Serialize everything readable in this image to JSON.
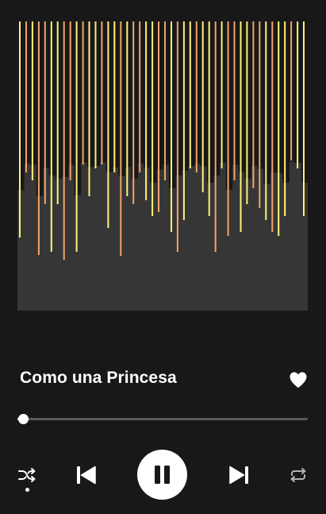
{
  "player": {
    "artwork": {
      "description_icon": "equalizer-bars-artwork",
      "colors": {
        "background": "#363636",
        "bar_yellow": "#fff27a",
        "bar_orange": "#f4a36c"
      }
    },
    "track": {
      "title": "Como una Princesa",
      "liked": true
    },
    "progress": {
      "fraction": 0.02
    },
    "controls": {
      "shuffle_icon": "shuffle-icon",
      "shuffle_active": true,
      "previous_icon": "skip-previous-icon",
      "play_pause_icon": "pause-icon",
      "playing": true,
      "next_icon": "skip-next-icon",
      "repeat_icon": "repeat-icon"
    },
    "theme": {
      "background": "#181818",
      "accent": "#ffffff",
      "inactive": "#5a5a5a"
    }
  }
}
